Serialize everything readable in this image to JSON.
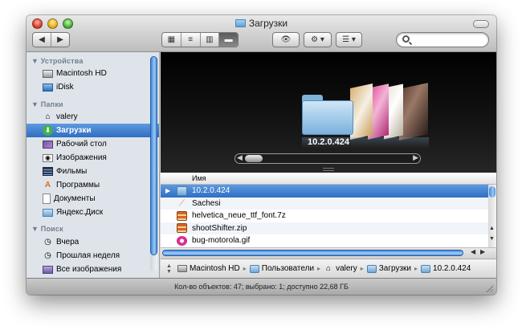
{
  "window": {
    "title": "Загрузки"
  },
  "toolbar": {
    "back_label": "◀",
    "forward_label": "▶",
    "views": [
      "▦",
      "≡",
      "▥",
      "▬"
    ],
    "quicklook_label": "👁",
    "action_label": "⚙ ▾",
    "arrange_label": "☰ ▾",
    "search_placeholder": ""
  },
  "sidebar": {
    "sections": [
      {
        "title": "▼ Устройства",
        "items": [
          {
            "label": "Macintosh HD",
            "icon": "hard-drive-icon"
          },
          {
            "label": "iDisk",
            "icon": "idisk-icon"
          }
        ]
      },
      {
        "title": "▼ Папки",
        "items": [
          {
            "label": "valery",
            "icon": "home-icon"
          },
          {
            "label": "Загрузки",
            "icon": "downloads-icon",
            "selected": true
          },
          {
            "label": "Рабочий стол",
            "icon": "desktop-icon"
          },
          {
            "label": "Изображения",
            "icon": "pictures-icon"
          },
          {
            "label": "Фильмы",
            "icon": "movies-icon"
          },
          {
            "label": "Программы",
            "icon": "applications-icon"
          },
          {
            "label": "Документы",
            "icon": "documents-icon"
          },
          {
            "label": "Яндекс.Диск",
            "icon": "folder-icon"
          }
        ]
      },
      {
        "title": "▼ Поиск",
        "items": [
          {
            "label": "Вчера",
            "icon": "clock-icon"
          },
          {
            "label": "Прошлая неделя",
            "icon": "clock-icon"
          },
          {
            "label": "Все изображения",
            "icon": "smart-folder-icon"
          }
        ]
      }
    ]
  },
  "coverflow": {
    "selected_label": "10.2.0.424"
  },
  "list": {
    "column_name": "Имя",
    "rows": [
      {
        "name": "10.2.0.424",
        "icon": "folder-icon",
        "selected": true
      },
      {
        "name": "Sachesi",
        "icon": "app-icon"
      },
      {
        "name": "helvetica_neue_ttf_font.7z",
        "icon": "archive-icon"
      },
      {
        "name": "shootShifter.zip",
        "icon": "archive-icon"
      },
      {
        "name": "bug-motorola.gif",
        "icon": "gif-icon"
      }
    ]
  },
  "pathbar": {
    "crumbs": [
      {
        "label": "Macintosh HD",
        "icon": "hard-drive-icon"
      },
      {
        "label": "Пользователи",
        "icon": "folder-icon"
      },
      {
        "label": "valery",
        "icon": "home-icon"
      },
      {
        "label": "Загрузки",
        "icon": "downloads-icon"
      },
      {
        "label": "10.2.0.424",
        "icon": "folder-icon"
      }
    ]
  },
  "status": {
    "text": "Кол-во объектов: 47; выбрано: 1; доступно 22,68 ГБ"
  }
}
